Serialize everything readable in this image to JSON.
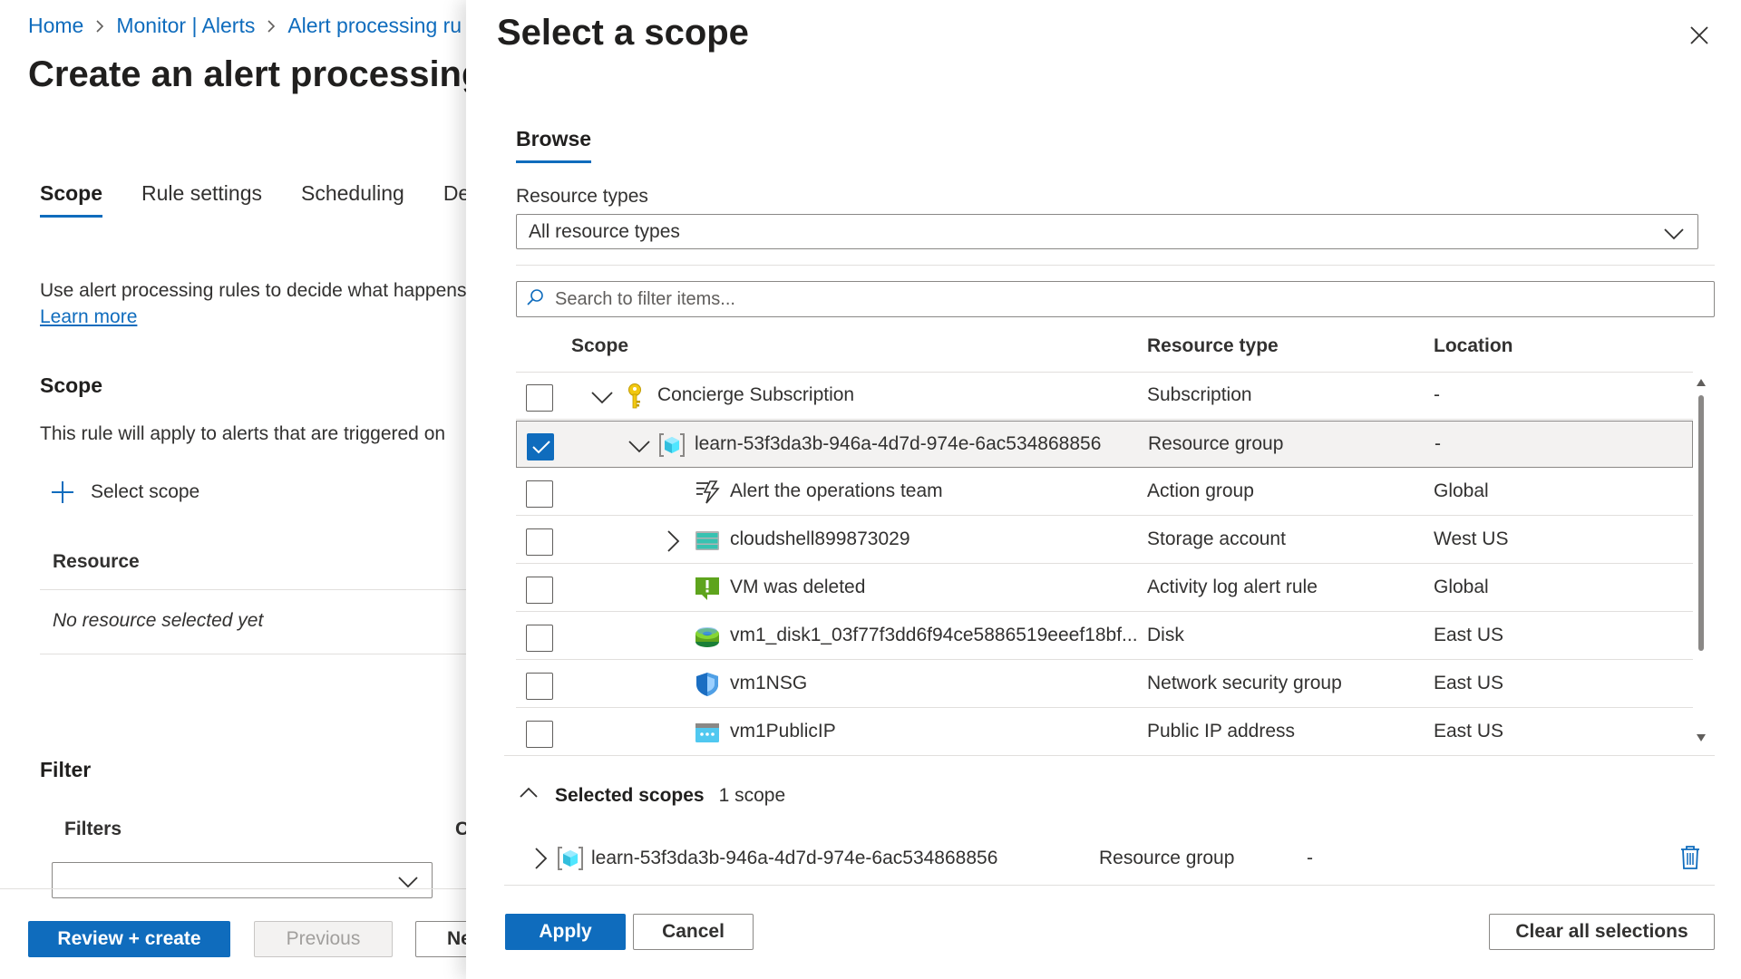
{
  "background": {
    "breadcrumb": [
      "Home",
      "Monitor | Alerts",
      "Alert processing ru"
    ],
    "title": "Create an alert processing",
    "tabs": [
      "Scope",
      "Rule settings",
      "Scheduling",
      "Det"
    ],
    "description": "Use alert processing rules to decide what happens",
    "learn_more": "Learn more",
    "scope_heading": "Scope",
    "scope_text": "This rule will apply to alerts that are triggered on",
    "select_scope": "Select scope",
    "resource_header": "Resource",
    "no_resource": "No resource selected yet",
    "filter_heading": "Filter",
    "filters_label": "Filters",
    "filters_col2": "C",
    "review_create": "Review + create",
    "previous": "Previous",
    "next": "Ne"
  },
  "panel": {
    "title": "Select a scope",
    "browse_tab": "Browse",
    "resource_types_label": "Resource types",
    "resource_types_value": "All resource types",
    "search_placeholder": "Search to filter items...",
    "columns": {
      "scope": "Scope",
      "resource_type": "Resource type",
      "location": "Location"
    },
    "rows": [
      {
        "name": "Concierge Subscription",
        "type": "Subscription",
        "location": "-",
        "checked": false,
        "icon": "key-icon",
        "expander": "chevron-down-icon",
        "level": 0
      },
      {
        "name": "learn-53f3da3b-946a-4d7d-974e-6ac534868856",
        "type": "Resource group",
        "location": "-",
        "checked": true,
        "icon": "resource-group-icon",
        "expander": "chevron-down-icon",
        "level": 1
      },
      {
        "name": "Alert the operations team",
        "type": "Action group",
        "location": "Global",
        "checked": false,
        "icon": "action-group-icon",
        "expander": "",
        "level": 2
      },
      {
        "name": "cloudshell899873029",
        "type": "Storage account",
        "location": "West US",
        "checked": false,
        "icon": "storage-account-icon",
        "expander": "chevron-right-icon",
        "level": 2
      },
      {
        "name": "VM was deleted",
        "type": "Activity log alert rule",
        "location": "Global",
        "checked": false,
        "icon": "alert-rule-icon",
        "expander": "",
        "level": 2
      },
      {
        "name": "vm1_disk1_03f77f3dd6f94ce5886519eeef18bf...",
        "type": "Disk",
        "location": "East US",
        "checked": false,
        "icon": "disk-icon",
        "expander": "",
        "level": 2
      },
      {
        "name": "vm1NSG",
        "type": "Network security group",
        "location": "East US",
        "checked": false,
        "icon": "network-security-group-icon",
        "expander": "",
        "level": 2
      },
      {
        "name": "vm1PublicIP",
        "type": "Public IP address",
        "location": "East US",
        "checked": false,
        "icon": "public-ip-icon",
        "expander": "",
        "level": 2
      }
    ],
    "selected_scopes": {
      "label": "Selected scopes",
      "count": "1 scope",
      "items": [
        {
          "name": "learn-53f3da3b-946a-4d7d-974e-6ac534868856",
          "type": "Resource group",
          "location": "-"
        }
      ]
    },
    "apply": "Apply",
    "cancel": "Cancel",
    "clear_all": "Clear all selections"
  },
  "colors": {
    "accent": "#0f6cbd",
    "text": "#323130",
    "border": "#8a8886",
    "selected_row": "#f3f2f1"
  }
}
